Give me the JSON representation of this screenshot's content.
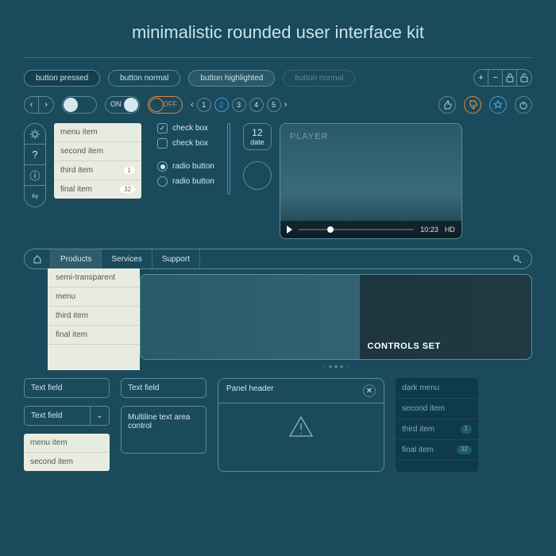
{
  "title": "minimalistic rounded user interface kit",
  "buttons": {
    "pressed": "button pressed",
    "normal": "button normal",
    "highlighted": "button highlighted",
    "disabled": "button normal"
  },
  "toggle": {
    "on": "ON",
    "off": "OFF"
  },
  "pager": {
    "nums": [
      "1",
      "2",
      "3",
      "4",
      "5"
    ]
  },
  "menu": {
    "items": [
      "menu item",
      "second item",
      "third item",
      "final item"
    ],
    "badges": [
      "",
      "",
      "1",
      "32"
    ]
  },
  "checks": {
    "c1": "check box",
    "c2": "check box"
  },
  "radios": {
    "r1": "radio button",
    "r2": "radio button"
  },
  "date": {
    "num": "12",
    "lbl": "date"
  },
  "player": {
    "label": "PLAYER",
    "time": "10:23",
    "hd": "HD"
  },
  "nav": {
    "items": [
      "Products",
      "Services",
      "Support"
    ]
  },
  "dropdown": {
    "items": [
      "semi-transparent",
      "menu",
      "third item",
      "final item"
    ]
  },
  "hero": {
    "label": "CONTROLS SET"
  },
  "fields": {
    "f1": "Text field",
    "f2": "Text field",
    "sel": "Text field",
    "multi": "Multiline text area control"
  },
  "selmenu": {
    "items": [
      "menu item",
      "second item"
    ]
  },
  "panel": {
    "hdr": "Panel header"
  },
  "darkmenu": {
    "items": [
      "dark menu",
      "second item",
      "third item",
      "final item"
    ],
    "badges": [
      "",
      "",
      "1",
      "32"
    ]
  }
}
